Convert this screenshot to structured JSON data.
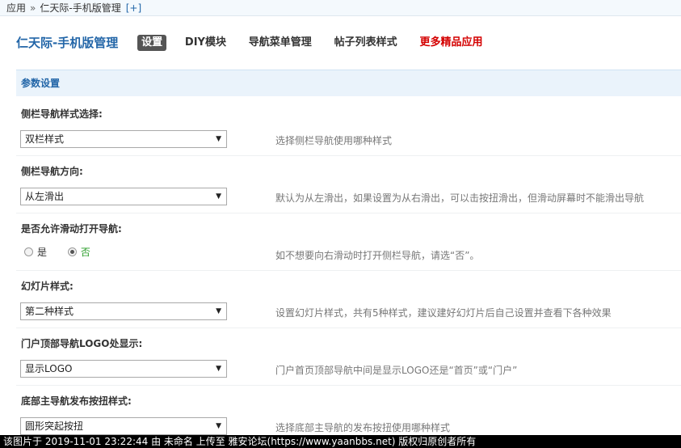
{
  "breadcrumb": {
    "root": "应用",
    "separator": "»",
    "current": "仁天际-手机版管理",
    "add": "[+]"
  },
  "header": {
    "title": "仁天际-手机版管理",
    "tabs": [
      "设置",
      "DIY模块",
      "导航菜单管理",
      "帖子列表样式",
      "更多精品应用"
    ]
  },
  "section": {
    "title": "参数设置"
  },
  "settings": {
    "sidebar_style": {
      "label": "侧栏导航样式选择:",
      "value": "双栏样式",
      "hint": "选择侧栏导航使用哪种样式"
    },
    "sidebar_direction": {
      "label": "侧栏导航方向:",
      "value": "从左滑出",
      "hint": "默认为从左滑出，如果设置为从右滑出，可以击按扭滑出，但滑动屏幕时不能滑出导航"
    },
    "swipe_open": {
      "label": "是否允许滑动打开导航:",
      "options": [
        "是",
        "否"
      ],
      "selected": "否",
      "hint": "如不想要向右滑动时打开侧栏导航，请选“否”。"
    },
    "slide_style": {
      "label": "幻灯片样式:",
      "value": "第二种样式",
      "hint": "设置幻灯片样式，共有5种样式，建议建好幻灯片后自己设置并查看下各种效果"
    },
    "portal_logo": {
      "label": "门户顶部导航LOGO处显示:",
      "value": "显示LOGO",
      "hint": "门户首页顶部导航中间是显示LOGO还是“首页”或“门户”"
    },
    "publish_button": {
      "label": "底部主导航发布按扭样式:",
      "value": "圆形突起按扭",
      "hint": "选择底部主导航的发布按扭使用哪种样式"
    }
  },
  "footer": {
    "text": "该图片于 2019-11-01 23:22:44 由 未命名 上传至 雅安论坛(https://www.yaanbbs.net) 版权归原创者所有"
  },
  "icons": {
    "dropdown_arrow": "▼"
  },
  "colors": {
    "title_blue": "#2366a8",
    "section_bg": "#eaf3fb",
    "more_red": "#d40000",
    "active_tab": "#555555",
    "selected_green": "#2a9d2a"
  }
}
